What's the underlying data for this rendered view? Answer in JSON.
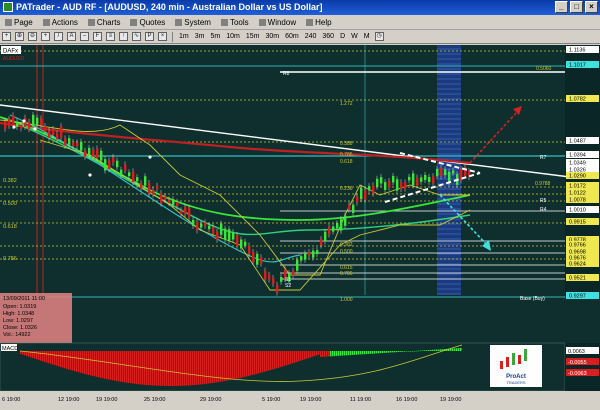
{
  "window": {
    "title": "PATrader - AUD RF - [AUDUSD, 240 min - Australian Dollar vs US Dollar]",
    "controls": [
      "_",
      "□",
      "×"
    ]
  },
  "menu": [
    {
      "label": "Page"
    },
    {
      "label": "Actions"
    },
    {
      "label": "Charts"
    },
    {
      "label": "Quotes"
    },
    {
      "label": "System"
    },
    {
      "label": "Tools"
    },
    {
      "label": "Window"
    },
    {
      "label": "Help"
    }
  ],
  "timeframes": [
    "1m",
    "3m",
    "5m",
    "10m",
    "15m",
    "30m",
    "60m",
    "240",
    "360",
    "D",
    "W",
    "M"
  ],
  "symbol_tag": "DAFx",
  "symbol_sub": "AUDUSD",
  "price_axis": [
    {
      "label": "1.1136",
      "style": "box"
    },
    {
      "label": "1.1017",
      "style": "cyan"
    },
    {
      "label": "1.0782",
      "style": "yellow"
    },
    {
      "label": "1.0487",
      "style": "box"
    },
    {
      "label": "1.0394",
      "style": "box"
    },
    {
      "label": "1.0349",
      "style": "box"
    },
    {
      "label": "1.0326",
      "style": "box"
    },
    {
      "label": "1.0290",
      "style": "yellow"
    },
    {
      "label": "1.0172",
      "style": "yellow"
    },
    {
      "label": "1.0122",
      "style": "yellow"
    },
    {
      "label": "1.0078",
      "style": "yellow"
    },
    {
      "label": "1.0010",
      "style": "box"
    },
    {
      "label": "0.9915",
      "style": "yellow"
    },
    {
      "label": "0.9778",
      "style": "yellow"
    },
    {
      "label": "0.9766",
      "style": "yellow"
    },
    {
      "label": "0.9698",
      "style": "yellow"
    },
    {
      "label": "0.9676",
      "style": "yellow"
    },
    {
      "label": "0.9624",
      "style": "yellow"
    },
    {
      "label": "0.9521",
      "style": "yellow"
    },
    {
      "label": "0.9297",
      "style": "cyan"
    }
  ],
  "fib_left": [
    "0.382",
    "0.500",
    "0.618",
    "0.786"
  ],
  "fib_labels": [
    {
      "text": "0.5060"
    },
    {
      "text": "R8"
    },
    {
      "text": "1.272"
    },
    {
      "text": "0.388"
    },
    {
      "text": "0.786"
    },
    {
      "text": "R7"
    },
    {
      "text": "0.618"
    },
    {
      "text": "0.9788"
    },
    {
      "text": "0.236"
    },
    {
      "text": "R5"
    },
    {
      "text": "0.382"
    },
    {
      "text": "R4"
    },
    {
      "text": "0.500"
    },
    {
      "text": "0.615"
    },
    {
      "text": "0.786"
    },
    {
      "text": "S1"
    },
    {
      "text": "S2"
    },
    {
      "text": "1.000"
    },
    {
      "text": "Base (Buy)"
    }
  ],
  "info_box": {
    "date": "13/09/2011 11:00",
    "open": "Open: 1.0319",
    "high": "High: 1.0348",
    "low": "Low: 1.0297",
    "close": "Close: 1.0326",
    "vol": "Vol.: 14922"
  },
  "macd": {
    "label": "MACD",
    "axis": [
      "0.0063",
      "-0.0055",
      "-0.0063"
    ]
  },
  "time_axis": [
    "6 19:00",
    "12 19:00",
    "19 19:00",
    "25 19:00",
    "29 19:00",
    "5 19:00",
    "19 19:00",
    "11 19:00",
    "16 19:00",
    "19 19:00"
  ],
  "logo": {
    "line1": "ProAct",
    "line2": "TRADERS"
  },
  "colors": {
    "bg": "#0f2f2f",
    "bull": "#39e639",
    "bear": "#d62020",
    "fib": "#c8c832",
    "cyan": "#3fe0e0",
    "white": "#ffffff"
  }
}
